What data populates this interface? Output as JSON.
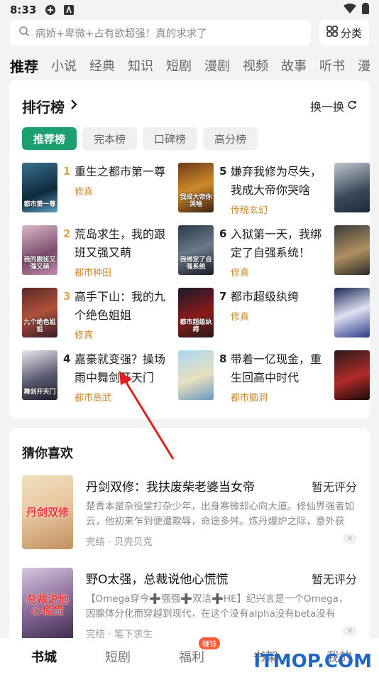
{
  "status_bar": {
    "time": "8:33"
  },
  "search": {
    "placeholder": "病娇+卑微+占有欲超强！真的求求了"
  },
  "category_button": {
    "label": "分类"
  },
  "top_tabs": [
    "推荐",
    "小说",
    "经典",
    "知识",
    "短剧",
    "漫剧",
    "视频",
    "故事",
    "听书",
    "漫"
  ],
  "ranking": {
    "title": "排行榜",
    "refresh_label": "换一换",
    "sub_tabs": [
      "推荐榜",
      "完本榜",
      "口碑榜",
      "高分榜"
    ],
    "books": [
      {
        "rank": "1",
        "title": "重生之都市第一尊",
        "tag": "修真",
        "cover_text": "都市第一尊"
      },
      {
        "rank": "2",
        "title": "荒岛求生，我的跟班又强又萌",
        "tag": "都市种田",
        "cover_text": "我的跟班又强又萌"
      },
      {
        "rank": "3",
        "title": "高手下山：我的九个绝色姐姐",
        "tag": "修真",
        "cover_text": "九个绝色姐姐"
      },
      {
        "rank": "4",
        "title": "嘉豪就变强？操场雨中舞剑开天门",
        "tag": "都市高武",
        "cover_text": "舞剑开天门"
      },
      {
        "rank": "5",
        "title": "嫌弃我修为尽失，我成大帝你哭啥",
        "tag": "传统玄幻",
        "cover_text": "我成大帝你哭啥"
      },
      {
        "rank": "6",
        "title": "入狱第一天，我绑定了自强系统！",
        "tag": "修真",
        "cover_text": "我绑定了自强系统"
      },
      {
        "rank": "7",
        "title": "都市超级纨绔",
        "tag": "修真",
        "cover_text": "都市超级纨绔"
      },
      {
        "rank": "8",
        "title": "带着一亿现金，重生回高中时代",
        "tag": "都市脑洞",
        "cover_text": ""
      }
    ]
  },
  "guess": {
    "title": "猜你喜欢",
    "items": [
      {
        "title": "丹剑双修：我扶废柴老婆当女帝",
        "score": "暂无评分",
        "desc": "楚青本是杂役堂打杂少年，出身寒微却心向大道。修仙界强者如云，他初来乍到便遭欺辱，命途多舛。炼丹爆炉之际，意外获得...",
        "meta": "完结 · 贝壳贝克",
        "cover_text": "丹剑双修"
      },
      {
        "title": "野O太强，总裁说他心慌慌",
        "score": "暂无评分",
        "desc": "【Omega穿今➕强强➕双洁➕HE】纪兴言是一个Omega，因腺体分化而穿越到现代，在这个没有alpha没有beta没有Omega的...",
        "meta": "完结 · 笔下求生",
        "cover_text": "总裁说他心慌慌"
      }
    ]
  },
  "bottom_nav": {
    "items": [
      "书城",
      "短剧",
      "福利",
      "书架",
      "我的"
    ],
    "badge": "赚钱"
  },
  "watermark": "ITMOP.COM",
  "colors": {
    "accent": "#1d9e6e",
    "tag": "#c8892e",
    "rank_top": "#e2a44b",
    "watermark": "#1f66c5",
    "arrow": "#e02020"
  }
}
